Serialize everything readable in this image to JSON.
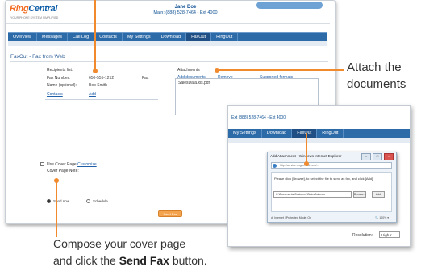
{
  "header": {
    "logo_ring": "Ring",
    "logo_central": "Central",
    "logo_tagline": "YOUR PHONE SYSTEM SIMPLIFIED",
    "user_name": "Jane Doe",
    "user_phone": "Main: (888) 528-7464 - Ext 4000"
  },
  "nav": {
    "tabs": [
      "Overview",
      "Messages",
      "Call Log",
      "Contacts",
      "My Settings",
      "Download",
      "FaxOut",
      "RingOut"
    ]
  },
  "page": {
    "title": "FaxOut - Fax from Web"
  },
  "form": {
    "recipients_label": "Recipients list:",
    "fax_number_label": "Fax Number:",
    "fax_number_value": "650-555-1212",
    "name_label": "Name (optional):",
    "name_value": "Bob Smith",
    "contacts_link": "Contacts",
    "add_link": "Add",
    "fax_col": "Fax"
  },
  "attachments": {
    "label": "Attachments",
    "add_documents": "Add documents",
    "remove": "Remove",
    "supported_formats": "Supported formats",
    "file_name": "SalesData.xls.pdf"
  },
  "cover": {
    "use_cover_label": "Use Cover Page",
    "customize": "Customize",
    "cover_note": "Cover Page Note:"
  },
  "options": {
    "send_now": "Send now",
    "schedule": "Schedule",
    "send_button": "Send Fax"
  },
  "window2": {
    "phone": "Ext (888) 528-7464 - Ext 4000",
    "tabs": [
      "My Settings",
      "Download",
      "FaxOut",
      "RingOut"
    ],
    "select_label": "Resolution:",
    "select_value": "High"
  },
  "dialog": {
    "title": "Add Attachment - Windows Internet Explorer",
    "url": "http://service.ringcentral.com/...",
    "message": "Please click [Browse], to select the file to send as fax, and click [Add].",
    "path_value": "C:\\Documents\\Customer\\SalesData.xls",
    "browse": "Browse...",
    "add": "Add",
    "status": "Internet | Protected Mode: On",
    "zoom": "100%"
  },
  "callouts": {
    "attach_line1": "Attach the",
    "attach_line2": "documents",
    "compose_line1": "Compose your cover page",
    "compose_prefix": "and click the ",
    "compose_bold": "Send Fax",
    "compose_suffix": " button."
  }
}
